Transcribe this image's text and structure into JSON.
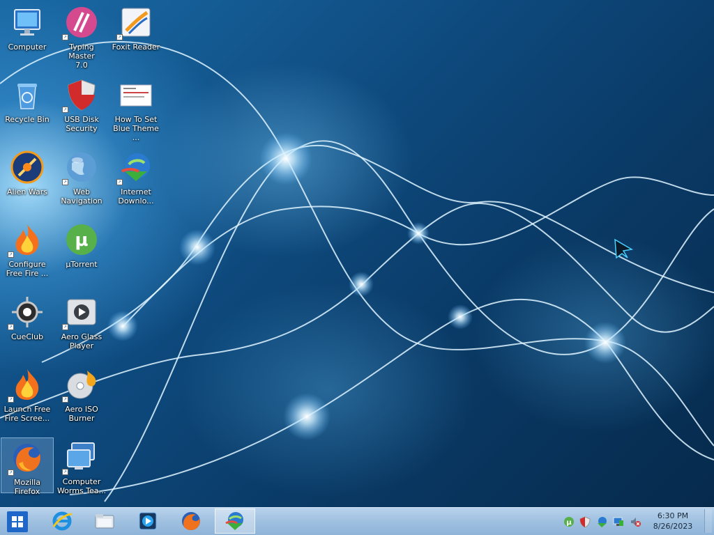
{
  "desktop": {
    "icons": [
      {
        "id": "computer",
        "label": "Computer",
        "icon": "computer-monitor-icon"
      },
      {
        "id": "typing-master",
        "label": "Typing Master\n7.0",
        "icon": "typing-master-icon"
      },
      {
        "id": "foxit",
        "label": "Foxit Reader",
        "icon": "foxit-reader-icon"
      },
      {
        "id": "recycle",
        "label": "Recycle Bin",
        "icon": "recycle-bin-icon"
      },
      {
        "id": "usb",
        "label": "USB Disk\nSecurity",
        "icon": "shield-icon"
      },
      {
        "id": "howto",
        "label": "How To Set\nBlue Theme ...",
        "icon": "document-thumbnail-icon"
      },
      {
        "id": "alien",
        "label": "Alien Wars",
        "icon": "alien-wars-icon"
      },
      {
        "id": "webnav",
        "label": "Web\nNavigation",
        "icon": "globe-icon"
      },
      {
        "id": "idm",
        "label": "Internet\nDownlo...",
        "icon": "internet-download-manager-icon"
      },
      {
        "id": "configff",
        "label": "Configure\nFree Fire ...",
        "icon": "flame-icon"
      },
      {
        "id": "utorrent",
        "label": "µTorrent",
        "icon": "utorrent-icon"
      },
      {
        "id": "cueclub",
        "label": "CueClub",
        "icon": "cueclub-icon"
      },
      {
        "id": "aeroglass",
        "label": "Aero Glass\nPlayer",
        "icon": "media-player-icon"
      },
      {
        "id": "launchff",
        "label": "Launch Free\nFire Scree...",
        "icon": "flame-icon"
      },
      {
        "id": "aeroiso",
        "label": "Aero ISO\nBurner",
        "icon": "disc-burner-icon"
      },
      {
        "id": "firefox",
        "label": "Mozilla\nFirefox",
        "icon": "firefox-icon",
        "selected": true
      },
      {
        "id": "worms",
        "label": "Computer\nWorms Tea...",
        "icon": "computer-worms-icon"
      }
    ]
  },
  "taskbar": {
    "start": {
      "icon": "windows-start-icon"
    },
    "pinned": [
      {
        "id": "ie",
        "icon": "internet-explorer-icon"
      },
      {
        "id": "explorer",
        "icon": "file-explorer-icon"
      },
      {
        "id": "media",
        "icon": "media-player-icon"
      },
      {
        "id": "firefox",
        "icon": "firefox-icon"
      },
      {
        "id": "idm",
        "icon": "internet-download-manager-icon",
        "active": true
      }
    ],
    "tray": [
      {
        "id": "utorrent",
        "icon": "utorrent-icon"
      },
      {
        "id": "usb-security",
        "icon": "shield-icon"
      },
      {
        "id": "idm",
        "icon": "internet-download-manager-icon"
      },
      {
        "id": "network",
        "icon": "network-icon"
      },
      {
        "id": "volume",
        "icon": "volume-muted-icon"
      }
    ],
    "clock": {
      "time": "6:30 PM",
      "date": "8/26/2023"
    }
  },
  "colors": {
    "taskbar": "#9fc0e0",
    "desktop": "#0e4a7e",
    "accent": "#2a8ad8"
  }
}
